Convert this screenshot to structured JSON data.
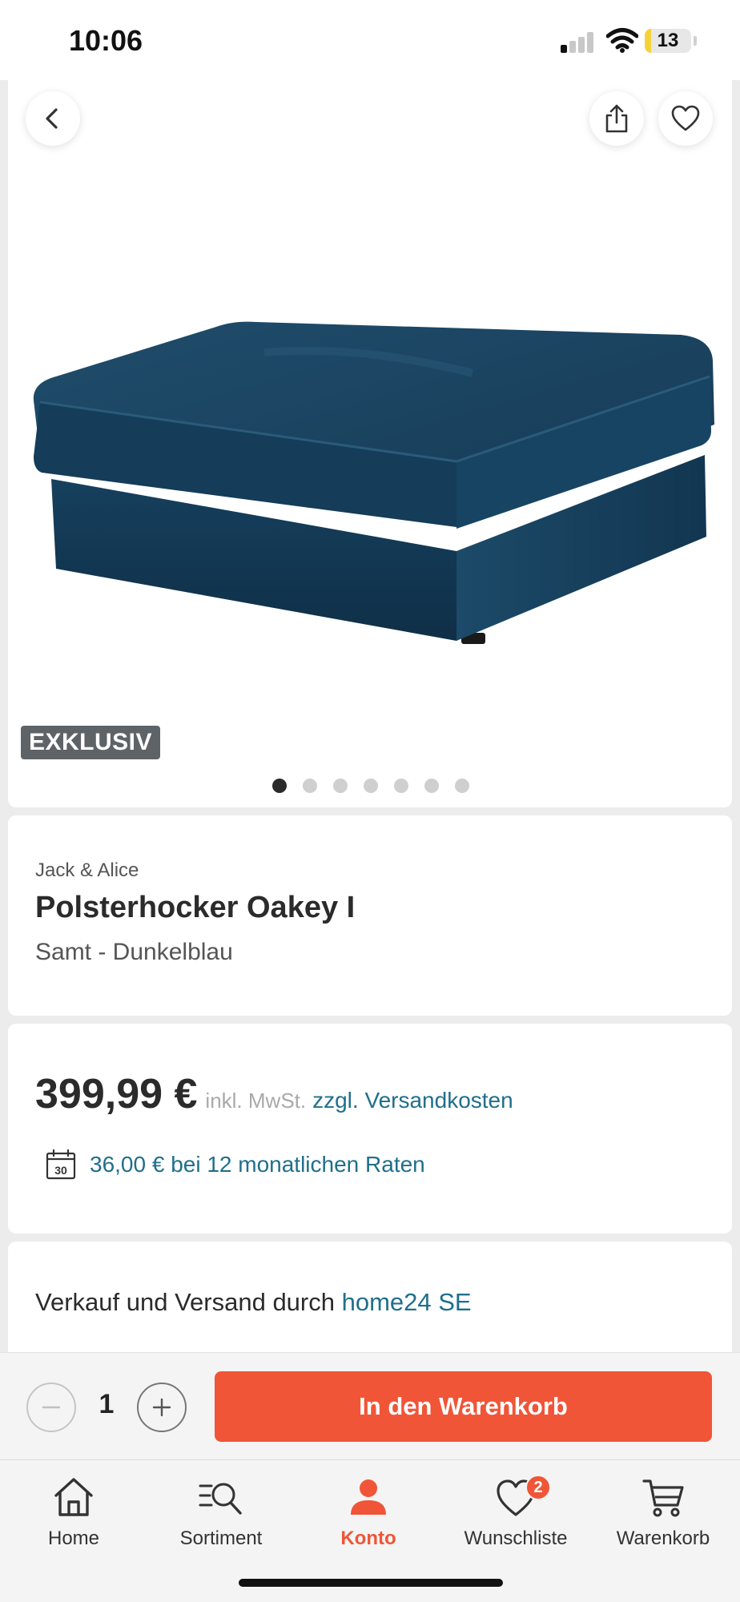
{
  "status_bar": {
    "time": "10:06",
    "battery": "13",
    "battery_level": 0.13
  },
  "gallery": {
    "badge": "EXKLUSIV",
    "image_count": 7,
    "active_index": 0,
    "product_color": "#1c4a66"
  },
  "product": {
    "brand": "Jack & Alice",
    "title": "Polsterhocker Oakey I",
    "variant": "Samt - Dunkelblau"
  },
  "pricing": {
    "price": "399,99 €",
    "vat_note": "inkl. MwSt.",
    "shipping_link": "zzgl. Versandkosten",
    "installment": "36,00 € bei 12 monatlichen Raten",
    "calendar_day": "30"
  },
  "seller": {
    "prefix": "Verkauf und Versand durch",
    "name": "home24 SE"
  },
  "cart": {
    "quantity": "1",
    "add_label": "In den Warenkorb"
  },
  "tabs": [
    {
      "label": "Home",
      "icon": "home-icon"
    },
    {
      "label": "Sortiment",
      "icon": "catalog-search-icon"
    },
    {
      "label": "Konto",
      "icon": "account-icon",
      "active": true
    },
    {
      "label": "Wunschliste",
      "icon": "heart-icon",
      "badge": "2"
    },
    {
      "label": "Warenkorb",
      "icon": "cart-icon"
    }
  ],
  "colors": {
    "accent": "#f05537",
    "link": "#1f6f8b",
    "badge_bg": "#5d6366"
  }
}
